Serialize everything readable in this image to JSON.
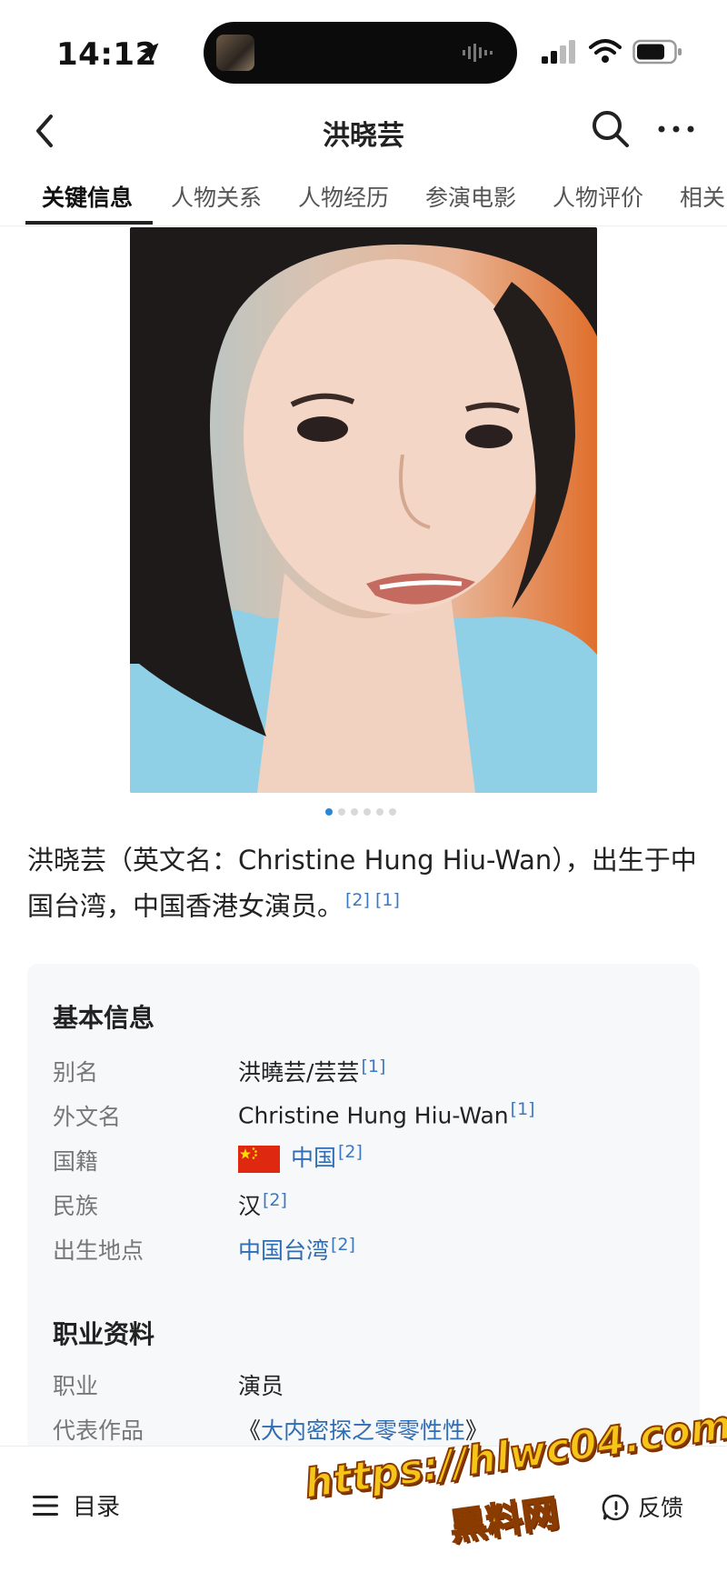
{
  "status_bar": {
    "time": "14:12"
  },
  "nav": {
    "title": "洪晓芸"
  },
  "tabs": [
    {
      "label": "关键信息",
      "active": true
    },
    {
      "label": "人物关系"
    },
    {
      "label": "人物经历"
    },
    {
      "label": "参演电影"
    },
    {
      "label": "人物评价"
    },
    {
      "label": "相关"
    }
  ],
  "carousel": {
    "count": 6,
    "active_index": 0
  },
  "summary": {
    "text": "洪晓芸（英文名：Christine Hung Hiu-Wan），出生于中国台湾，中国香港女演员。",
    "refs": "[2] [1]"
  },
  "basic_info": {
    "title": "基本信息",
    "rows": [
      {
        "label": "别名",
        "value": "洪曉芸/芸芸",
        "ref": "[1]"
      },
      {
        "label": "外文名",
        "value": "Christine Hung Hiu-Wan",
        "ref": "[1]"
      },
      {
        "label": "国籍",
        "value": "中国",
        "ref": "[2]"
      },
      {
        "label": "民族",
        "value": "汉",
        "ref": "[2]"
      },
      {
        "label": "出生地点",
        "value": "中国台湾",
        "ref": "[2]"
      }
    ]
  },
  "career_info": {
    "title": "职业资料",
    "rows": [
      {
        "label": "职业",
        "value": "演员"
      },
      {
        "label": "代表作品",
        "prefix": "《",
        "value": "大内密探之零零性性",
        "suffix": "》"
      }
    ]
  },
  "bottom": {
    "menu_label": "目录",
    "feedback_label": "反馈"
  },
  "watermark": {
    "url": "https://hlwc04.com",
    "name": "黑料网"
  },
  "colors": {
    "link": "#2f6db5",
    "accent": "#2a86d6",
    "flag": "#de2910",
    "watermark": "#f5c518"
  },
  "icons": [
    "location-arrow-icon",
    "signal-icon",
    "wifi-icon",
    "battery-icon",
    "back-chevron-icon",
    "search-icon",
    "more-icon",
    "menu-icon",
    "feedback-icon",
    "china-flag-icon"
  ]
}
